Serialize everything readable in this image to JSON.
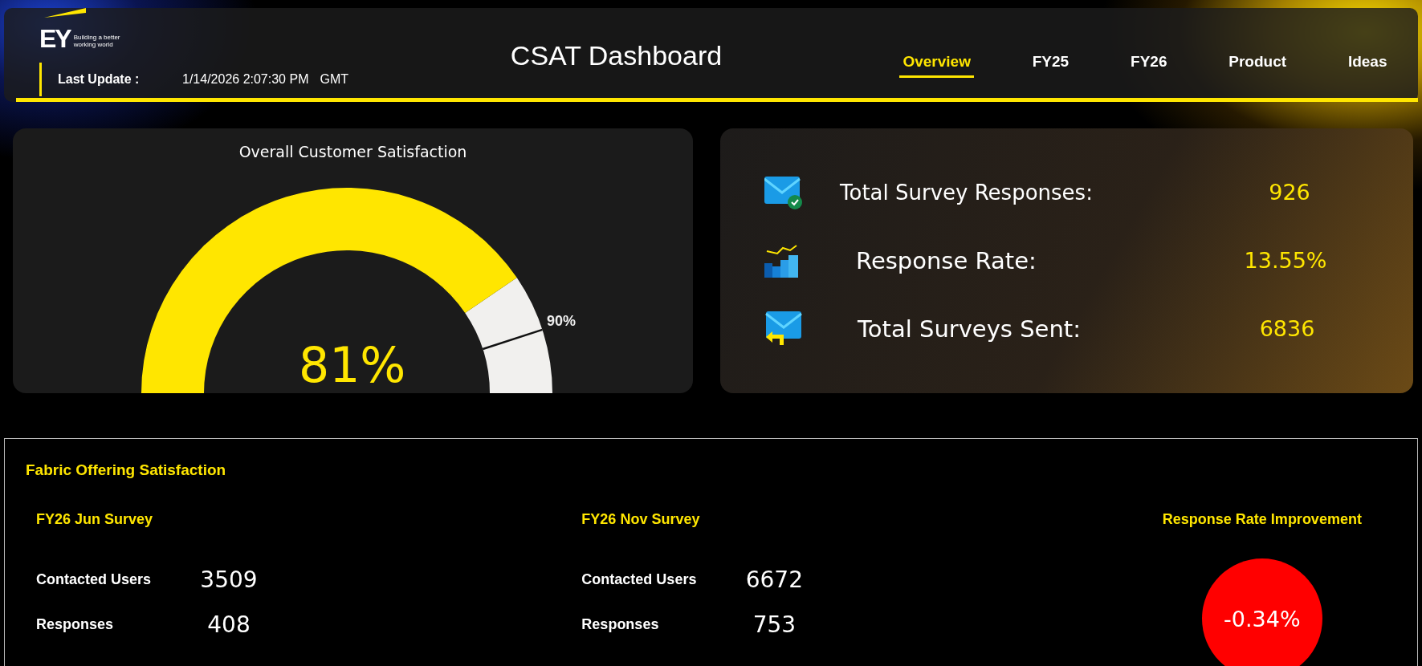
{
  "header": {
    "logo": {
      "wordmark": "EY",
      "tagline": "Building a better working world"
    },
    "last_update": {
      "label": "Last Update :",
      "value": "1/14/2026 2:07:30 PM",
      "timezone": "GMT"
    },
    "title": "CSAT Dashboard",
    "tabs": [
      {
        "label": "Overview",
        "selected": true
      },
      {
        "label": "FY25",
        "selected": false
      },
      {
        "label": "FY26",
        "selected": false
      },
      {
        "label": "Product",
        "selected": false
      },
      {
        "label": "Ideas",
        "selected": false
      }
    ]
  },
  "satisfaction_gauge": {
    "title": "Overall Customer Satisfaction",
    "value": "81%",
    "target_label": "90%"
  },
  "summary": [
    {
      "kind": "responses",
      "label": "Total Survey Responses:",
      "value": "926"
    },
    {
      "kind": "rate",
      "label": "Response Rate:",
      "value": "13.55%"
    },
    {
      "kind": "sent",
      "label": "Total Surveys Sent:",
      "value": "6836"
    }
  ],
  "fabric_offering": {
    "title": "Fabric Offering Satisfaction",
    "surveys": [
      {
        "title": "FY26 Jun Survey",
        "rows": [
          {
            "label": "Contacted Users",
            "value": "3509"
          },
          {
            "label": "Responses",
            "value": "408"
          }
        ]
      },
      {
        "title": "FY26 Nov Survey",
        "rows": [
          {
            "label": "Contacted Users",
            "value": "6672"
          },
          {
            "label": "Responses",
            "value": "753"
          }
        ]
      }
    ],
    "improvement": {
      "title": "Response Rate Improvement",
      "value": "-0.34%"
    }
  }
}
